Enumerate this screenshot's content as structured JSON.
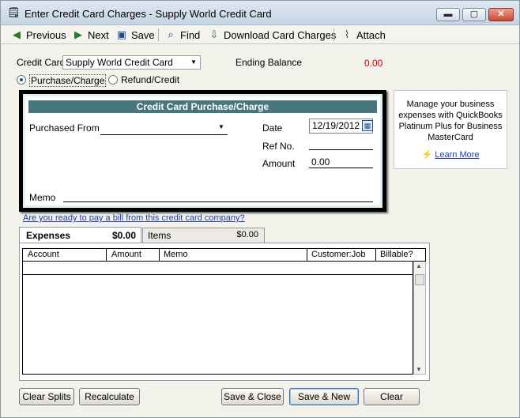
{
  "window": {
    "title": "Enter Credit Card Charges - Supply World Credit Card",
    "min_glyph": "▬",
    "max_glyph": "▢",
    "close_glyph": "✕"
  },
  "toolbar": {
    "previous": "Previous",
    "next": "Next",
    "save": "Save",
    "find": "Find",
    "download": "Download Card Charges",
    "attach": "Attach"
  },
  "header": {
    "credit_card_label": "Credit Card",
    "credit_card_value": "Supply World Credit Card",
    "ending_balance_label": "Ending Balance",
    "ending_balance_value": "0.00",
    "radio_purchase": "Purchase/Charge",
    "radio_refund": "Refund/Credit"
  },
  "form": {
    "heading": "Credit Card Purchase/Charge",
    "purchased_from_label": "Purchased From",
    "purchased_from_value": "",
    "date_label": "Date",
    "date_value": "12/19/2012",
    "ref_label": "Ref No.",
    "ref_value": "",
    "amount_label": "Amount",
    "amount_value": "0.00",
    "memo_label": "Memo",
    "memo_value": ""
  },
  "ad": {
    "text_line1": "Manage your business",
    "text_line2": "expenses with QuickBooks",
    "text_line3": "Platinum Plus for Business",
    "text_line4": "MasterCard",
    "learn_more": "Learn More"
  },
  "bill_link": "Are you ready to pay a bill from this credit card company?",
  "tabs": [
    {
      "label": "Expenses",
      "amount": "$0.00"
    },
    {
      "label": "Items",
      "amount": "$0.00"
    }
  ],
  "grid": {
    "columns": [
      "Account",
      "Amount",
      "Memo",
      "Customer:Job",
      "Billable?"
    ]
  },
  "buttons": {
    "clear_splits": "Clear Splits",
    "recalculate": "Recalculate",
    "save_close": "Save & Close",
    "save_new": "Save & New",
    "clear": "Clear"
  },
  "colors": {
    "header_bar": "#46777c",
    "ending_balance": "#cc0000",
    "link": "#1f3cae"
  }
}
